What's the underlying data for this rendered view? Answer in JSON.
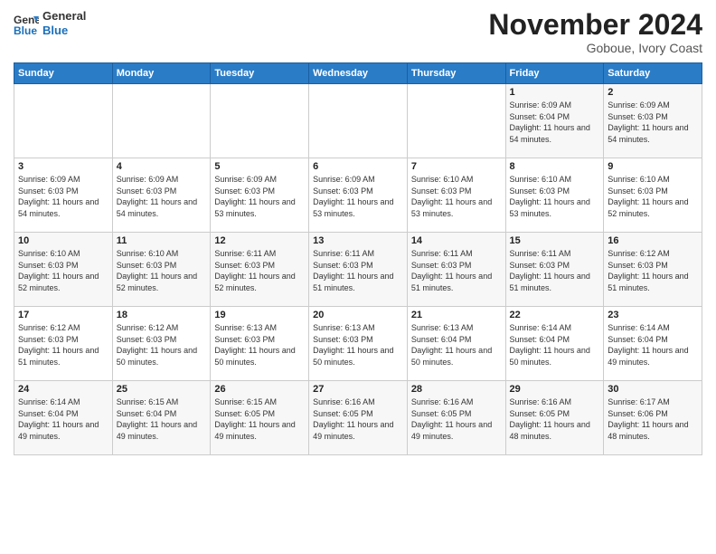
{
  "header": {
    "logo_line1": "General",
    "logo_line2": "Blue",
    "month": "November 2024",
    "location": "Goboue, Ivory Coast"
  },
  "weekdays": [
    "Sunday",
    "Monday",
    "Tuesday",
    "Wednesday",
    "Thursday",
    "Friday",
    "Saturday"
  ],
  "weeks": [
    [
      {
        "day": "",
        "info": ""
      },
      {
        "day": "",
        "info": ""
      },
      {
        "day": "",
        "info": ""
      },
      {
        "day": "",
        "info": ""
      },
      {
        "day": "",
        "info": ""
      },
      {
        "day": "1",
        "info": "Sunrise: 6:09 AM\nSunset: 6:04 PM\nDaylight: 11 hours and 54 minutes."
      },
      {
        "day": "2",
        "info": "Sunrise: 6:09 AM\nSunset: 6:03 PM\nDaylight: 11 hours and 54 minutes."
      }
    ],
    [
      {
        "day": "3",
        "info": "Sunrise: 6:09 AM\nSunset: 6:03 PM\nDaylight: 11 hours and 54 minutes."
      },
      {
        "day": "4",
        "info": "Sunrise: 6:09 AM\nSunset: 6:03 PM\nDaylight: 11 hours and 54 minutes."
      },
      {
        "day": "5",
        "info": "Sunrise: 6:09 AM\nSunset: 6:03 PM\nDaylight: 11 hours and 53 minutes."
      },
      {
        "day": "6",
        "info": "Sunrise: 6:09 AM\nSunset: 6:03 PM\nDaylight: 11 hours and 53 minutes."
      },
      {
        "day": "7",
        "info": "Sunrise: 6:10 AM\nSunset: 6:03 PM\nDaylight: 11 hours and 53 minutes."
      },
      {
        "day": "8",
        "info": "Sunrise: 6:10 AM\nSunset: 6:03 PM\nDaylight: 11 hours and 53 minutes."
      },
      {
        "day": "9",
        "info": "Sunrise: 6:10 AM\nSunset: 6:03 PM\nDaylight: 11 hours and 52 minutes."
      }
    ],
    [
      {
        "day": "10",
        "info": "Sunrise: 6:10 AM\nSunset: 6:03 PM\nDaylight: 11 hours and 52 minutes."
      },
      {
        "day": "11",
        "info": "Sunrise: 6:10 AM\nSunset: 6:03 PM\nDaylight: 11 hours and 52 minutes."
      },
      {
        "day": "12",
        "info": "Sunrise: 6:11 AM\nSunset: 6:03 PM\nDaylight: 11 hours and 52 minutes."
      },
      {
        "day": "13",
        "info": "Sunrise: 6:11 AM\nSunset: 6:03 PM\nDaylight: 11 hours and 51 minutes."
      },
      {
        "day": "14",
        "info": "Sunrise: 6:11 AM\nSunset: 6:03 PM\nDaylight: 11 hours and 51 minutes."
      },
      {
        "day": "15",
        "info": "Sunrise: 6:11 AM\nSunset: 6:03 PM\nDaylight: 11 hours and 51 minutes."
      },
      {
        "day": "16",
        "info": "Sunrise: 6:12 AM\nSunset: 6:03 PM\nDaylight: 11 hours and 51 minutes."
      }
    ],
    [
      {
        "day": "17",
        "info": "Sunrise: 6:12 AM\nSunset: 6:03 PM\nDaylight: 11 hours and 51 minutes."
      },
      {
        "day": "18",
        "info": "Sunrise: 6:12 AM\nSunset: 6:03 PM\nDaylight: 11 hours and 50 minutes."
      },
      {
        "day": "19",
        "info": "Sunrise: 6:13 AM\nSunset: 6:03 PM\nDaylight: 11 hours and 50 minutes."
      },
      {
        "day": "20",
        "info": "Sunrise: 6:13 AM\nSunset: 6:03 PM\nDaylight: 11 hours and 50 minutes."
      },
      {
        "day": "21",
        "info": "Sunrise: 6:13 AM\nSunset: 6:04 PM\nDaylight: 11 hours and 50 minutes."
      },
      {
        "day": "22",
        "info": "Sunrise: 6:14 AM\nSunset: 6:04 PM\nDaylight: 11 hours and 50 minutes."
      },
      {
        "day": "23",
        "info": "Sunrise: 6:14 AM\nSunset: 6:04 PM\nDaylight: 11 hours and 49 minutes."
      }
    ],
    [
      {
        "day": "24",
        "info": "Sunrise: 6:14 AM\nSunset: 6:04 PM\nDaylight: 11 hours and 49 minutes."
      },
      {
        "day": "25",
        "info": "Sunrise: 6:15 AM\nSunset: 6:04 PM\nDaylight: 11 hours and 49 minutes."
      },
      {
        "day": "26",
        "info": "Sunrise: 6:15 AM\nSunset: 6:05 PM\nDaylight: 11 hours and 49 minutes."
      },
      {
        "day": "27",
        "info": "Sunrise: 6:16 AM\nSunset: 6:05 PM\nDaylight: 11 hours and 49 minutes."
      },
      {
        "day": "28",
        "info": "Sunrise: 6:16 AM\nSunset: 6:05 PM\nDaylight: 11 hours and 49 minutes."
      },
      {
        "day": "29",
        "info": "Sunrise: 6:16 AM\nSunset: 6:05 PM\nDaylight: 11 hours and 48 minutes."
      },
      {
        "day": "30",
        "info": "Sunrise: 6:17 AM\nSunset: 6:06 PM\nDaylight: 11 hours and 48 minutes."
      }
    ]
  ]
}
